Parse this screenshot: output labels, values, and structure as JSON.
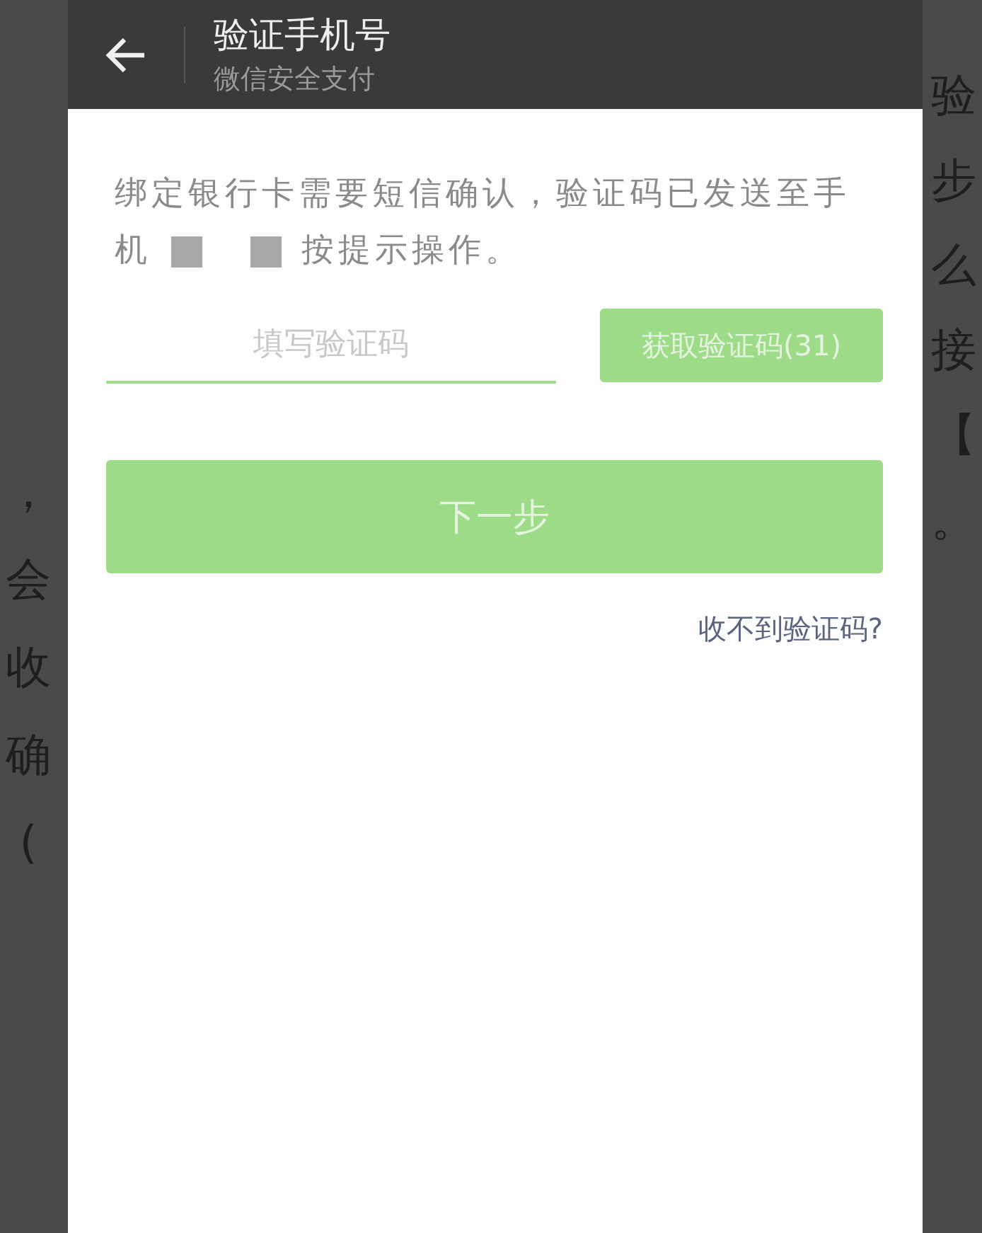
{
  "background": {
    "left_edge": [
      "，",
      "会",
      "收",
      "确",
      "("
    ],
    "right_edge": [
      "验",
      "步",
      "么",
      "接",
      "【",
      "。"
    ]
  },
  "dialog": {
    "title": "验证手机号",
    "subtitle": "微信安全支付",
    "message": {
      "before": "绑定银行卡需要短信确认，验证码已发送至手机",
      "after": "按提示操作。"
    },
    "code_field": {
      "placeholder": "填写验证码"
    },
    "get_code_button": {
      "label": "获取验证码(31)",
      "disabled": true
    },
    "next_button": {
      "label": "下一步",
      "disabled": true
    },
    "help_link": "收不到验证码?"
  }
}
